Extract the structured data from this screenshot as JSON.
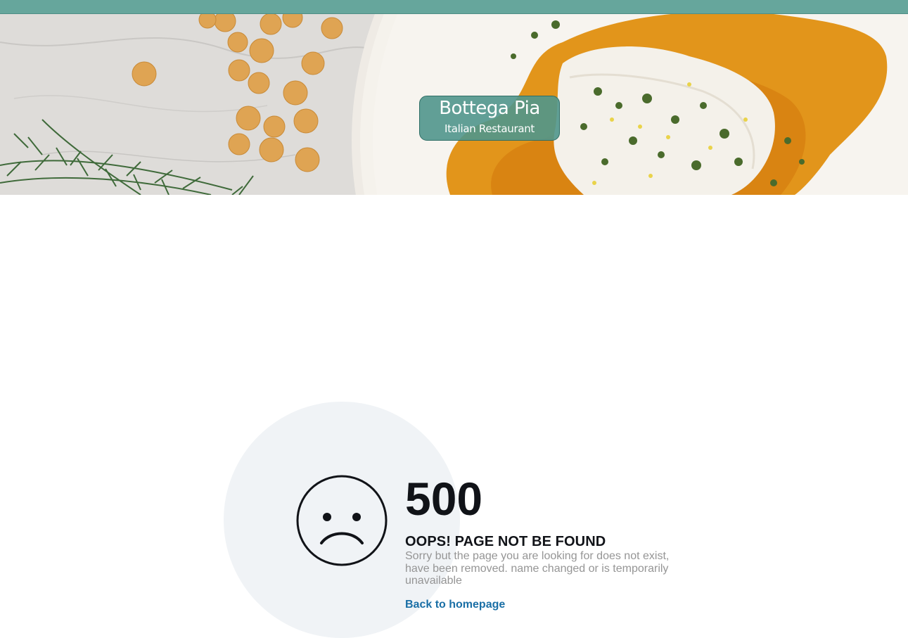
{
  "header": {
    "brand_name": "Bottega Pia",
    "brand_tagline": "Italian Restaurant"
  },
  "error": {
    "icon": "sad-face-icon",
    "code": "500",
    "headline": "OOPS! PAGE NOT BE FOUND",
    "message": "Sorry but the page you are looking for does not exist, have been removed. name changed or is temporarily unavailable",
    "back_link": "Back to homepage"
  },
  "colors": {
    "topbar": "#66a69c",
    "brand_box": "#50968c",
    "link": "#1a6fa6",
    "circle": "#f0f3f6",
    "text_dark": "#111318",
    "text_muted": "#959595"
  }
}
